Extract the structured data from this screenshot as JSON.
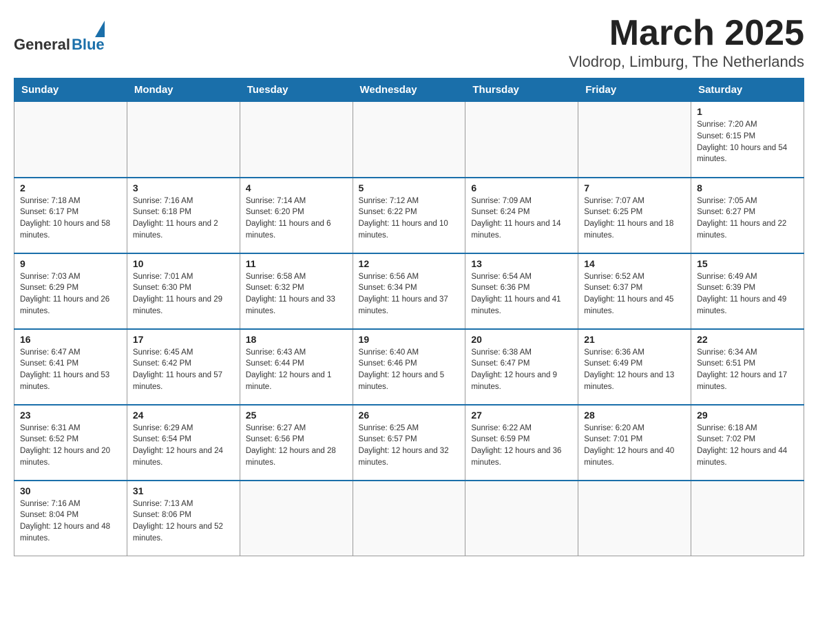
{
  "header": {
    "logo_general": "General",
    "logo_blue": "Blue",
    "title": "March 2025",
    "subtitle": "Vlodrop, Limburg, The Netherlands"
  },
  "days_of_week": [
    "Sunday",
    "Monday",
    "Tuesday",
    "Wednesday",
    "Thursday",
    "Friday",
    "Saturday"
  ],
  "weeks": [
    [
      {
        "day": "",
        "info": ""
      },
      {
        "day": "",
        "info": ""
      },
      {
        "day": "",
        "info": ""
      },
      {
        "day": "",
        "info": ""
      },
      {
        "day": "",
        "info": ""
      },
      {
        "day": "",
        "info": ""
      },
      {
        "day": "1",
        "info": "Sunrise: 7:20 AM\nSunset: 6:15 PM\nDaylight: 10 hours and 54 minutes."
      }
    ],
    [
      {
        "day": "2",
        "info": "Sunrise: 7:18 AM\nSunset: 6:17 PM\nDaylight: 10 hours and 58 minutes."
      },
      {
        "day": "3",
        "info": "Sunrise: 7:16 AM\nSunset: 6:18 PM\nDaylight: 11 hours and 2 minutes."
      },
      {
        "day": "4",
        "info": "Sunrise: 7:14 AM\nSunset: 6:20 PM\nDaylight: 11 hours and 6 minutes."
      },
      {
        "day": "5",
        "info": "Sunrise: 7:12 AM\nSunset: 6:22 PM\nDaylight: 11 hours and 10 minutes."
      },
      {
        "day": "6",
        "info": "Sunrise: 7:09 AM\nSunset: 6:24 PM\nDaylight: 11 hours and 14 minutes."
      },
      {
        "day": "7",
        "info": "Sunrise: 7:07 AM\nSunset: 6:25 PM\nDaylight: 11 hours and 18 minutes."
      },
      {
        "day": "8",
        "info": "Sunrise: 7:05 AM\nSunset: 6:27 PM\nDaylight: 11 hours and 22 minutes."
      }
    ],
    [
      {
        "day": "9",
        "info": "Sunrise: 7:03 AM\nSunset: 6:29 PM\nDaylight: 11 hours and 26 minutes."
      },
      {
        "day": "10",
        "info": "Sunrise: 7:01 AM\nSunset: 6:30 PM\nDaylight: 11 hours and 29 minutes."
      },
      {
        "day": "11",
        "info": "Sunrise: 6:58 AM\nSunset: 6:32 PM\nDaylight: 11 hours and 33 minutes."
      },
      {
        "day": "12",
        "info": "Sunrise: 6:56 AM\nSunset: 6:34 PM\nDaylight: 11 hours and 37 minutes."
      },
      {
        "day": "13",
        "info": "Sunrise: 6:54 AM\nSunset: 6:36 PM\nDaylight: 11 hours and 41 minutes."
      },
      {
        "day": "14",
        "info": "Sunrise: 6:52 AM\nSunset: 6:37 PM\nDaylight: 11 hours and 45 minutes."
      },
      {
        "day": "15",
        "info": "Sunrise: 6:49 AM\nSunset: 6:39 PM\nDaylight: 11 hours and 49 minutes."
      }
    ],
    [
      {
        "day": "16",
        "info": "Sunrise: 6:47 AM\nSunset: 6:41 PM\nDaylight: 11 hours and 53 minutes."
      },
      {
        "day": "17",
        "info": "Sunrise: 6:45 AM\nSunset: 6:42 PM\nDaylight: 11 hours and 57 minutes."
      },
      {
        "day": "18",
        "info": "Sunrise: 6:43 AM\nSunset: 6:44 PM\nDaylight: 12 hours and 1 minute."
      },
      {
        "day": "19",
        "info": "Sunrise: 6:40 AM\nSunset: 6:46 PM\nDaylight: 12 hours and 5 minutes."
      },
      {
        "day": "20",
        "info": "Sunrise: 6:38 AM\nSunset: 6:47 PM\nDaylight: 12 hours and 9 minutes."
      },
      {
        "day": "21",
        "info": "Sunrise: 6:36 AM\nSunset: 6:49 PM\nDaylight: 12 hours and 13 minutes."
      },
      {
        "day": "22",
        "info": "Sunrise: 6:34 AM\nSunset: 6:51 PM\nDaylight: 12 hours and 17 minutes."
      }
    ],
    [
      {
        "day": "23",
        "info": "Sunrise: 6:31 AM\nSunset: 6:52 PM\nDaylight: 12 hours and 20 minutes."
      },
      {
        "day": "24",
        "info": "Sunrise: 6:29 AM\nSunset: 6:54 PM\nDaylight: 12 hours and 24 minutes."
      },
      {
        "day": "25",
        "info": "Sunrise: 6:27 AM\nSunset: 6:56 PM\nDaylight: 12 hours and 28 minutes."
      },
      {
        "day": "26",
        "info": "Sunrise: 6:25 AM\nSunset: 6:57 PM\nDaylight: 12 hours and 32 minutes."
      },
      {
        "day": "27",
        "info": "Sunrise: 6:22 AM\nSunset: 6:59 PM\nDaylight: 12 hours and 36 minutes."
      },
      {
        "day": "28",
        "info": "Sunrise: 6:20 AM\nSunset: 7:01 PM\nDaylight: 12 hours and 40 minutes."
      },
      {
        "day": "29",
        "info": "Sunrise: 6:18 AM\nSunset: 7:02 PM\nDaylight: 12 hours and 44 minutes."
      }
    ],
    [
      {
        "day": "30",
        "info": "Sunrise: 7:16 AM\nSunset: 8:04 PM\nDaylight: 12 hours and 48 minutes."
      },
      {
        "day": "31",
        "info": "Sunrise: 7:13 AM\nSunset: 8:06 PM\nDaylight: 12 hours and 52 minutes."
      },
      {
        "day": "",
        "info": ""
      },
      {
        "day": "",
        "info": ""
      },
      {
        "day": "",
        "info": ""
      },
      {
        "day": "",
        "info": ""
      },
      {
        "day": "",
        "info": ""
      }
    ]
  ]
}
